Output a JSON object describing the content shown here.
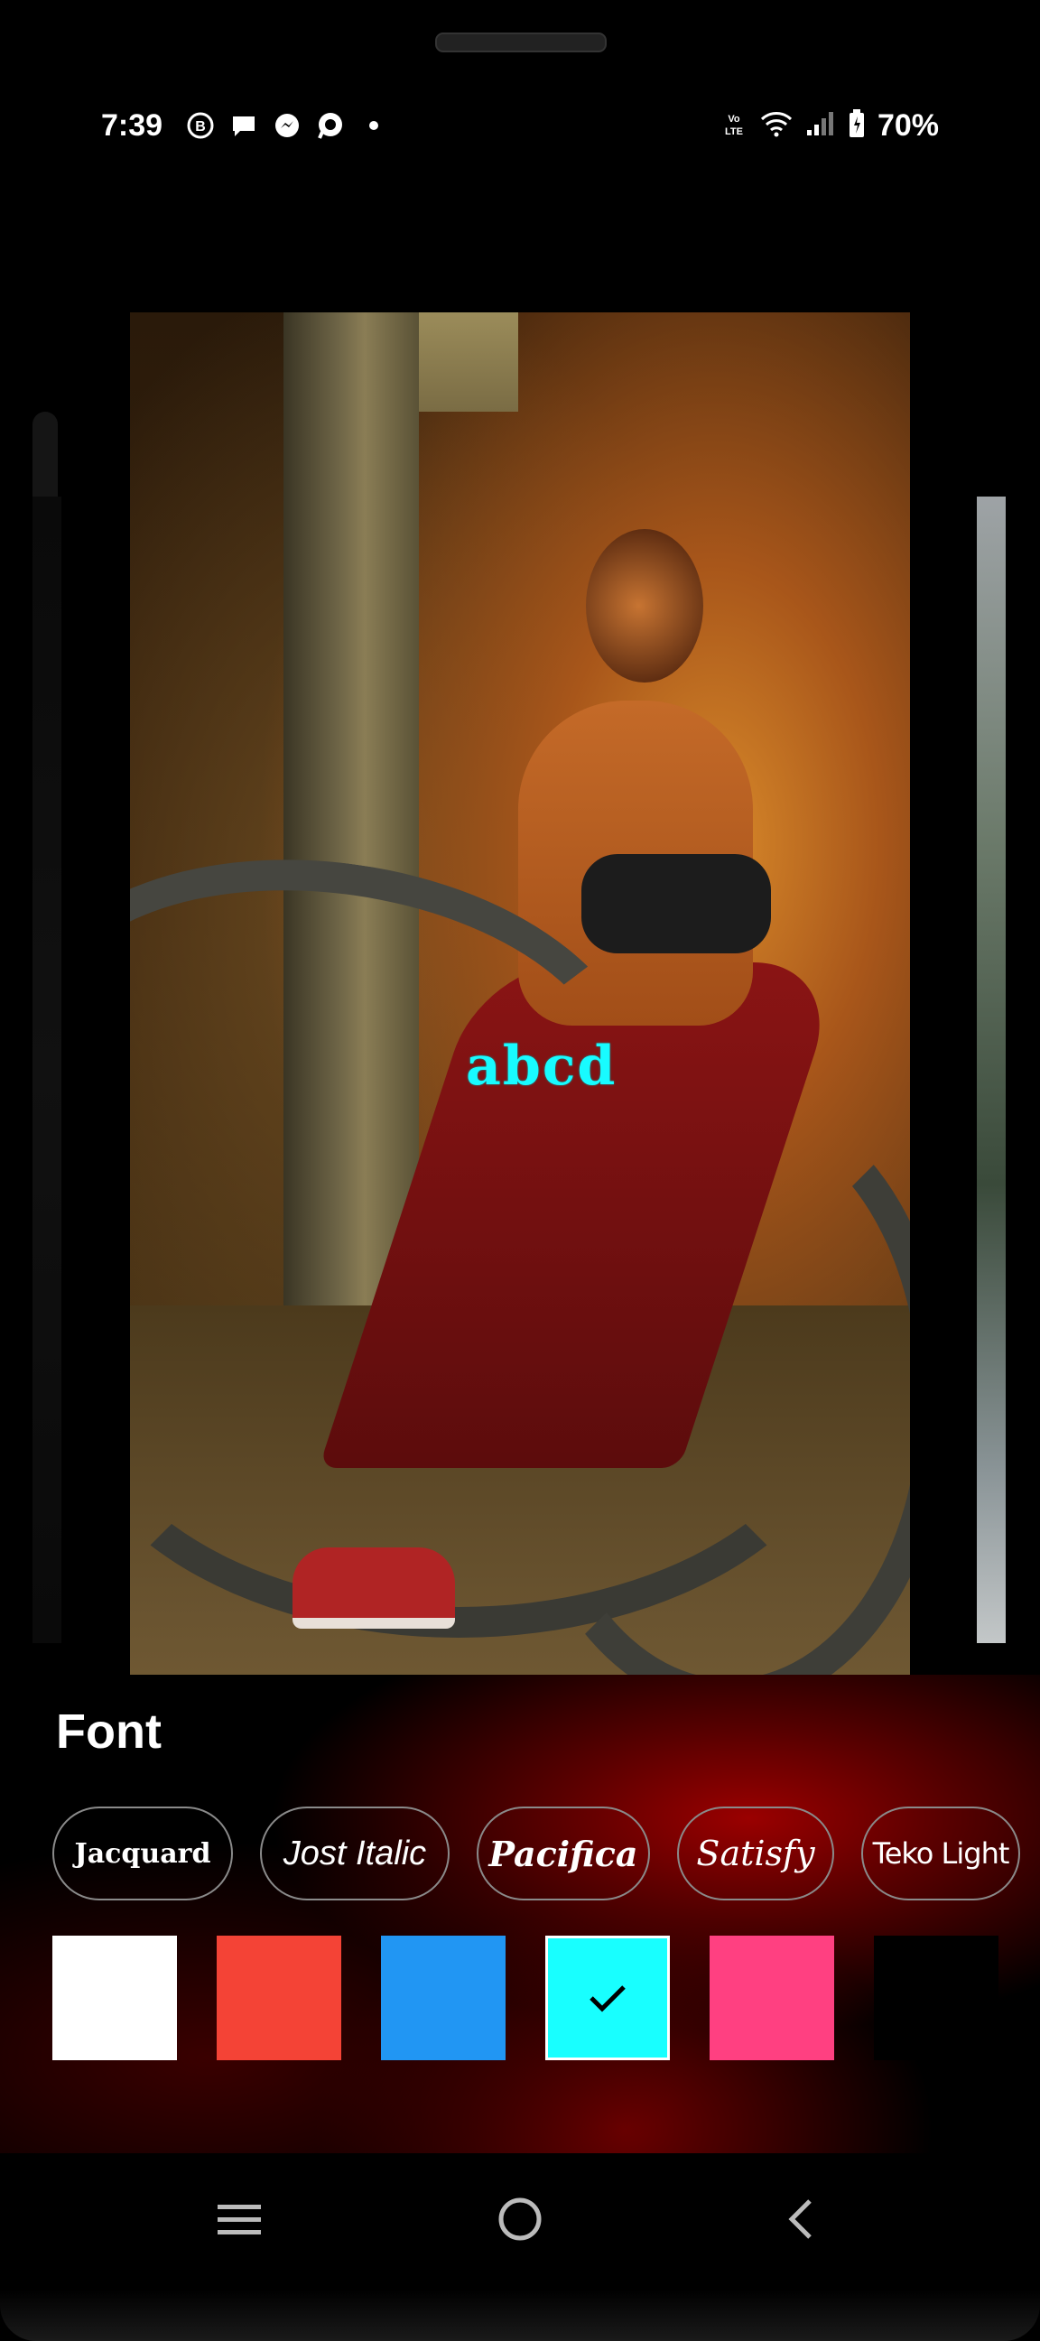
{
  "status_bar": {
    "time": "7:39",
    "battery": "70%",
    "left_icons": [
      "b-icon",
      "chat-bubble-icon",
      "messenger-icon",
      "whatsapp-icon",
      "dot-icon"
    ],
    "right_icons": [
      "volte-icon",
      "wifi-icon",
      "signal-icon",
      "battery-icon"
    ]
  },
  "canvas": {
    "overlay_text": "abcd",
    "overlay_color": "#18FBFF"
  },
  "panel": {
    "title": "Font",
    "fonts": [
      {
        "label": "Jacquard",
        "selected": false
      },
      {
        "label": "Jost Italic",
        "selected": false
      },
      {
        "label": "Pacifica",
        "selected": false
      },
      {
        "label": "Satisfy",
        "selected": false
      },
      {
        "label": "Teko Light",
        "selected": false
      }
    ],
    "colors": [
      {
        "name": "white",
        "hex": "#FFFFFF",
        "selected": false
      },
      {
        "name": "red",
        "hex": "#F44336",
        "selected": false
      },
      {
        "name": "blue",
        "hex": "#2196F3",
        "selected": false
      },
      {
        "name": "cyan",
        "hex": "#18FFFF",
        "selected": true
      },
      {
        "name": "pink",
        "hex": "#FF4081",
        "selected": false
      },
      {
        "name": "black",
        "hex": "#000000",
        "selected": false
      }
    ]
  },
  "nav_bar": {
    "buttons": [
      "recents-icon",
      "home-icon",
      "back-icon"
    ]
  }
}
